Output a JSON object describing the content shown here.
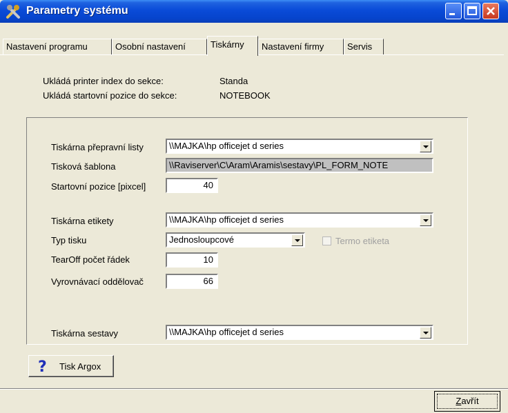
{
  "window": {
    "title": "Parametry systému",
    "app_icon": "tools-icon",
    "controls": [
      "minimize-icon",
      "maximize-icon",
      "close-icon"
    ]
  },
  "tabs": [
    {
      "label": "Nastavení programu",
      "active": false
    },
    {
      "label": "Osobní nastavení",
      "active": false
    },
    {
      "label": "Tiskárny",
      "active": true
    },
    {
      "label": "Nastavení firmy",
      "active": false
    },
    {
      "label": "Servis",
      "active": false
    }
  ],
  "info": {
    "printer_index_label": "Ukládá printer index do sekce:",
    "printer_index_value": "Standa",
    "start_pos_label": "Ukládá startovní pozice do sekce:",
    "start_pos_value": "NOTEBOOK"
  },
  "form": {
    "shipping_printer_label": "Tiskárna přepravní listy",
    "shipping_printer_value": "\\\\MAJKA\\hp officejet d series",
    "template_label": "Tisková šablona",
    "template_value": "\\\\Raviserver\\C\\Aram\\Aramis\\sestavy\\PL_FORM_NOTE",
    "start_pos_label": "Startovní pozice [pixcel]",
    "start_pos_value": "40",
    "label_printer_label": "Tiskárna etikety",
    "label_printer_value": "\\\\MAJKA\\hp officejet d series",
    "print_type_label": "Typ tisku",
    "print_type_value": "Jednosloupcové",
    "thermo_label": "Termo etiketa",
    "tearoff_label": "TearOff počet řádek",
    "tearoff_value": "10",
    "separator_label": "Vyrovnávací oddělovač",
    "separator_value": "66",
    "report_printer_label": "Tiskárna sestavy",
    "report_printer_value": "\\\\MAJKA\\hp officejet d series"
  },
  "buttons": {
    "argox_label": "Tisk Argox",
    "argox_icon": "help-question-icon",
    "close_label_mnemonic": "Z",
    "close_label_rest": "avřít"
  },
  "colors": {
    "titlebar": "#0a4bd8",
    "face": "#ece9d8",
    "close_button": "#c7381f",
    "readonly_field": "#c0c0c0"
  }
}
